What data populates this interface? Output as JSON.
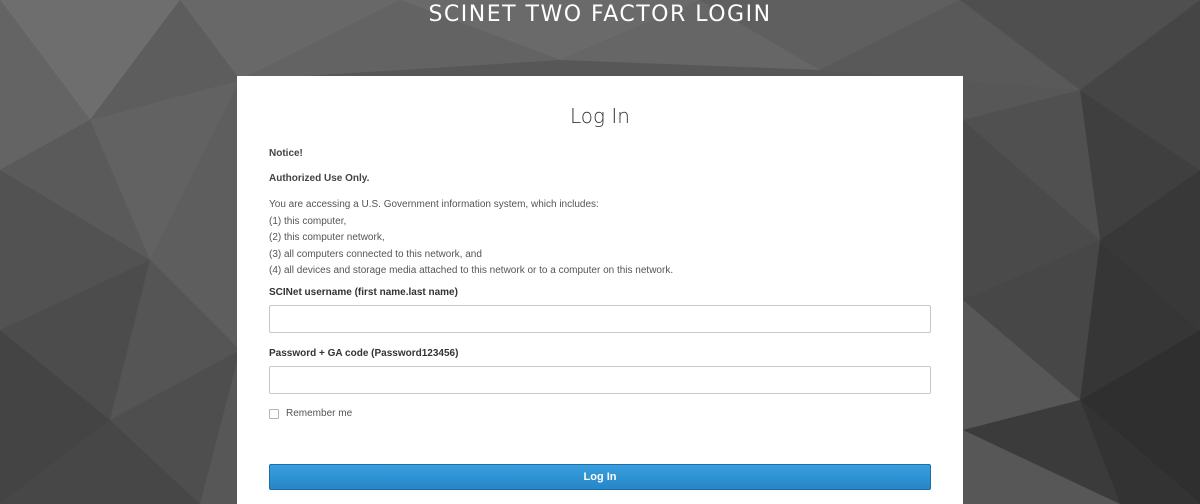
{
  "header": {
    "title": "SCINET TWO FACTOR LOGIN"
  },
  "login_card": {
    "title": "Log In",
    "notice_heading": "Notice!",
    "notice_subheading": "Authorized Use Only.",
    "notice_lines": [
      "You are accessing a U.S. Government information system, which includes:",
      "(1) this computer,",
      "(2) this computer network,",
      "(3) all computers connected to this network, and",
      "(4) all devices and storage media attached to this network or to a computer on this network."
    ],
    "username_label": "SCINet username (first name.last name)",
    "username_value": "",
    "password_label": "Password + GA code (Password123456)",
    "password_value": "",
    "remember_label": "Remember me",
    "remember_checked": false,
    "submit_label": "Log In"
  },
  "colors": {
    "accent": "#2b8fd4",
    "card_background": "#ffffff",
    "page_background": "#4a4a4a"
  },
  "icons": {
    "checkbox": "unchecked-checkbox-icon"
  }
}
